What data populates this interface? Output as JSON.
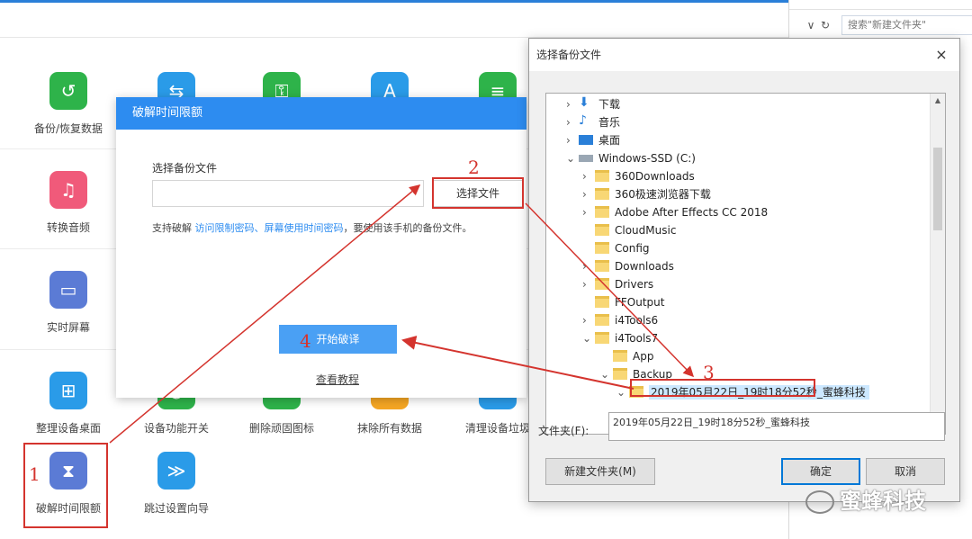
{
  "search_placeholder": "搜索\"新建文件夹\"",
  "tools": [
    {
      "label": "备份/恢复数据",
      "icon": "backup-restore-icon",
      "color": "#2eb34a"
    },
    {
      "label": "",
      "icon": "transfer-data-icon",
      "color": "#2a9be8"
    },
    {
      "label": "",
      "icon": "usb-icon",
      "color": "#2eb34a"
    },
    {
      "label": "",
      "icon": "app-store-icon",
      "color": "#2a9be8"
    },
    {
      "label": "",
      "icon": "apple-id-icon",
      "color": "#2eb34a"
    },
    {
      "label": "转换音频",
      "icon": "music-icon",
      "color": "#f05a7a"
    },
    {
      "label": "实时屏幕",
      "icon": "screen-icon",
      "color": "#5b7bd5"
    },
    {
      "label": "整理设备桌面",
      "icon": "grid-icon",
      "color": "#2a9be8"
    },
    {
      "label": "设备功能开关",
      "icon": "toggle-icon",
      "color": "#2eb34a"
    },
    {
      "label": "删除顽固图标",
      "icon": "delete-icon-icon",
      "color": "#2eb34a"
    },
    {
      "label": "抹除所有数据",
      "icon": "erase-icon",
      "color": "#f5a623"
    },
    {
      "label": "清理设备垃圾",
      "icon": "clean-icon",
      "color": "#2a9be8"
    },
    {
      "label": "破解时间限额",
      "icon": "hourglass-icon",
      "color": "#5b7bd5"
    },
    {
      "label": "跳过设置向导",
      "icon": "skip-wizard-icon",
      "color": "#2a9be8"
    }
  ],
  "crack_dialog": {
    "title": "破解时间限额",
    "select_label": "选择备份文件",
    "path_value": "",
    "choose_button": "选择文件",
    "hint_prefix": "支持破解",
    "hint_link1": "访问限制密码",
    "hint_sep": "、",
    "hint_link2": "屏幕使用时间密码",
    "hint_suffix": "，要使用该手机的备份文件。",
    "start_button": "开始破译",
    "tutorial_link": "查看教程"
  },
  "file_dialog": {
    "title": "选择备份文件",
    "close": "×",
    "tree": [
      {
        "name": "下载",
        "icon": "download-arrow-icon",
        "level": 1,
        "expander": "›"
      },
      {
        "name": "音乐",
        "icon": "music-note-icon",
        "level": 1,
        "expander": "›"
      },
      {
        "name": "桌面",
        "icon": "desktop-icon",
        "level": 1,
        "expander": "›"
      },
      {
        "name": "Windows-SSD (C:)",
        "icon": "drive-icon",
        "level": 1,
        "expander": "⌄"
      },
      {
        "name": "360Downloads",
        "icon": "folder-icon",
        "level": 2,
        "expander": "›"
      },
      {
        "name": "360极速浏览器下载",
        "icon": "folder-icon",
        "level": 2,
        "expander": "›"
      },
      {
        "name": "Adobe After Effects CC 2018",
        "icon": "folder-icon",
        "level": 2,
        "expander": "›"
      },
      {
        "name": "CloudMusic",
        "icon": "folder-icon",
        "level": 2,
        "expander": ""
      },
      {
        "name": "Config",
        "icon": "folder-icon",
        "level": 2,
        "expander": ""
      },
      {
        "name": "Downloads",
        "icon": "folder-icon",
        "level": 2,
        "expander": "›"
      },
      {
        "name": "Drivers",
        "icon": "folder-icon",
        "level": 2,
        "expander": "›"
      },
      {
        "name": "FFOutput",
        "icon": "folder-icon",
        "level": 2,
        "expander": ""
      },
      {
        "name": "i4Tools6",
        "icon": "folder-icon",
        "level": 2,
        "expander": "›"
      },
      {
        "name": "i4Tools7",
        "icon": "folder-icon",
        "level": 2,
        "expander": "⌄"
      },
      {
        "name": "App",
        "icon": "folder-icon",
        "level": 3,
        "expander": ""
      },
      {
        "name": "Backup",
        "icon": "folder-icon",
        "level": 3,
        "expander": "⌄"
      },
      {
        "name": "2019年05月22日_19时18分52秒_蜜蜂科技",
        "icon": "folder-icon",
        "level": 4,
        "expander": "⌄",
        "selected": true
      }
    ],
    "folder_label": "文件夹(F):",
    "folder_value": "2019年05月22日_19时18分52秒_蜜蜂科技",
    "new_folder_button": "新建文件夹(M)",
    "ok_button": "确定",
    "cancel_button": "取消"
  },
  "annotations": [
    "1",
    "2",
    "3",
    "4"
  ],
  "watermark": "蜜蜂科技",
  "colors": {
    "accent": "#2d8cf0",
    "annotation": "#d4342e"
  }
}
